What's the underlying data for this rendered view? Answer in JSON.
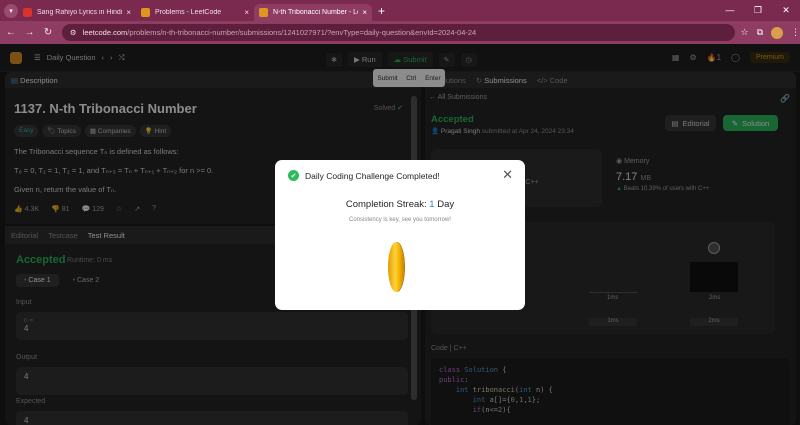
{
  "browser": {
    "tabs": [
      {
        "title": "Sang Rahiyo Lyrics in Hindi, Sa",
        "fav": "#d9322e",
        "active": false
      },
      {
        "title": "Problems - LeetCode",
        "fav": "#e0951f",
        "active": false
      },
      {
        "title": "N-th Tribonacci Number - Leet",
        "fav": "#e0951f",
        "active": true
      }
    ],
    "new_tab": "+",
    "url_main": "leetcode.com",
    "url_rest": "/problems/n-th-tribonacci-number/submissions/1241027971/?envType=daily-question&envId=2024-04-24"
  },
  "header": {
    "daily_label": "Daily Question",
    "run_label": "Run",
    "submit_label": "Submit",
    "streak_count": "1",
    "premium_label": "Premium"
  },
  "shortcut": {
    "a": "Submit",
    "b": "Ctrl",
    "c": "Enter"
  },
  "left": {
    "tab_description": "Description",
    "title": "1137. N-th Tribonacci Number",
    "solved": "Solved",
    "tags": [
      "Easy",
      "Topics",
      "Companies",
      "Hint"
    ],
    "desc_line1": "The Tribonacci sequence Tₙ is defined as follows:",
    "desc_line2": "T₀ = 0, T₁ = 1, T₂ = 1, and Tₙ₊₃ = Tₙ + Tₙ₊₁ + Tₙ₊₂ for n >= 0.",
    "desc_line3": "Given n, return the value of Tₙ.",
    "likes": "4.3K",
    "dislikes": "81",
    "comments": "129",
    "bottom_tabs": [
      "Editorial",
      "Testcase",
      "Test Result"
    ],
    "result": "Accepted",
    "runtime": "Runtime: 0 ms",
    "case1": "Case 1",
    "case2": "Case 2",
    "input_label": "Input",
    "input_key": "n =",
    "input_value": "4",
    "output_label": "Output",
    "output_value": "4",
    "expected_label": "Expected",
    "expected_value": "4"
  },
  "right": {
    "tabs": [
      "Solutions",
      "Submissions",
      "Code"
    ],
    "back": "All Submissions",
    "status": "Accepted",
    "user": "Pragati Singh",
    "submitted": "submitted at Apr 24, 2024 23:34",
    "editorial_label": "Editorial",
    "solution_label": "Solution",
    "memory_label": "Memory",
    "memory_value": "7.17",
    "memory_unit": "MB",
    "beats": "Beats 10.39% of users with C++",
    "runtime_sub": "with C++",
    "bar_label_a": "1ms",
    "bar_label_b": "2ms",
    "axis_a": "1ms",
    "axis_b": "2ms",
    "code_label": "Code",
    "lang": "C++",
    "code_lines": [
      "class Solution {",
      "public:",
      "    int tribonacci(int n) {",
      "        int a[]={0,1,1};",
      "        if(n<=2){"
    ]
  },
  "modal": {
    "title": "Daily Coding Challenge Completed!",
    "streak_label": "Completion Streak:",
    "streak_value": "1",
    "streak_unit": "Day",
    "message": "Consistency is key, see you tomorrow!"
  },
  "colors": {
    "accent_green": "#2cbb5d",
    "streak_blue": "#2b7cd8",
    "browser_bar": "#8e3c62"
  }
}
